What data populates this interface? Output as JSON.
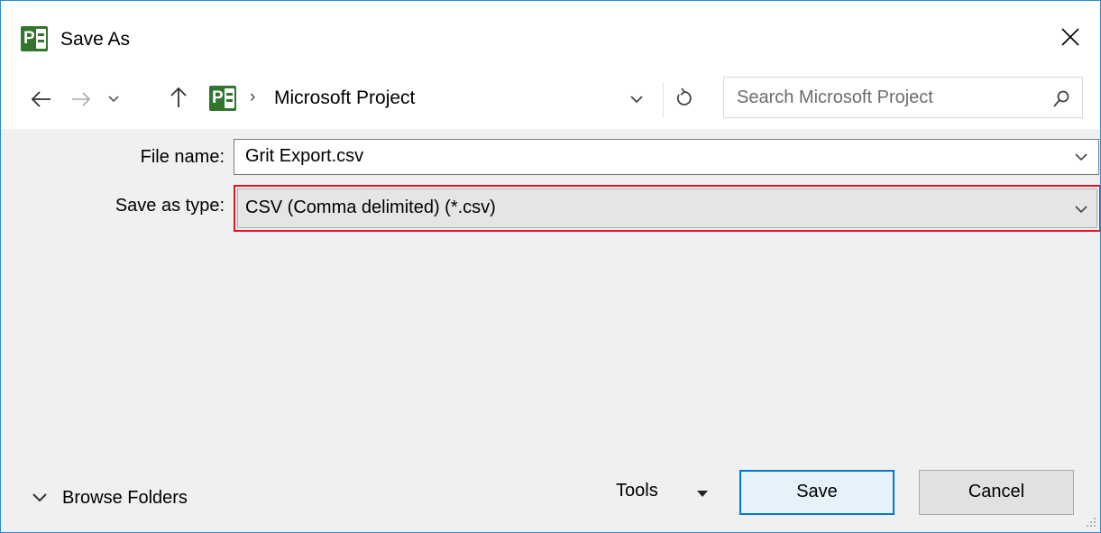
{
  "window": {
    "title": "Save As",
    "accent_color": "#0078d7",
    "app_icon": "microsoft-project-icon"
  },
  "navigation": {
    "back_icon": "arrow-left-icon",
    "forward_icon": "arrow-right-icon",
    "recent_icon": "chevron-down-icon",
    "up_icon": "arrow-up-icon",
    "breadcrumb_separator": "›",
    "location": "Microsoft Project",
    "search_placeholder": "Search Microsoft Project"
  },
  "form": {
    "file_name_label": "File name:",
    "file_name_value": "Grit Export.csv",
    "save_as_type_label": "Save as type:",
    "save_as_type_value": "CSV (Comma delimited) (*.csv)",
    "highlight_color": "#e81123"
  },
  "footer": {
    "browse_folders_label": "Browse Folders",
    "tools_label": "Tools",
    "save_label": "Save",
    "cancel_label": "Cancel"
  }
}
